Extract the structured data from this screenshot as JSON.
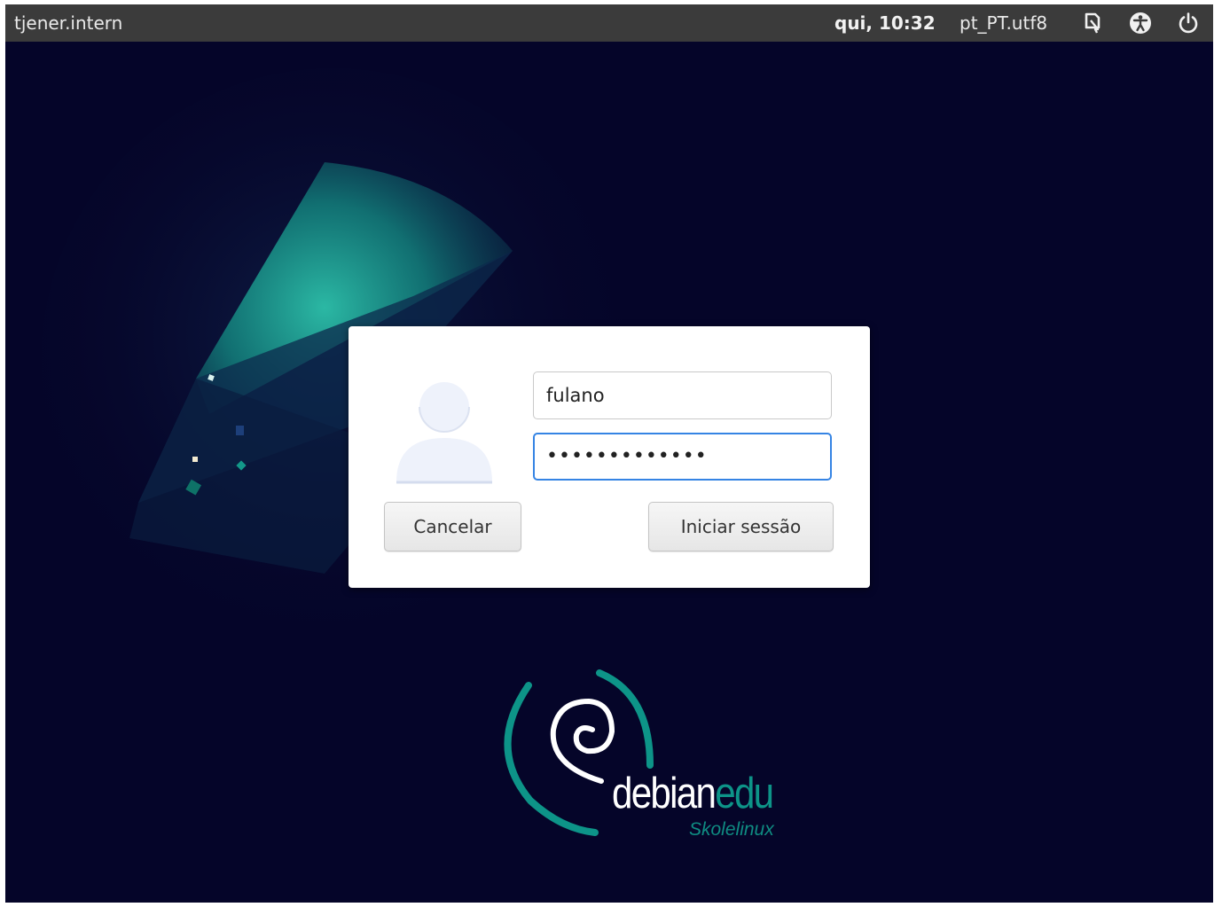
{
  "topbar": {
    "hostname": "tjener.intern",
    "clock": "qui, 10:32",
    "locale": "pt_PT.utf8",
    "icons": [
      "screen-keyboard-icon",
      "accessibility-icon",
      "power-icon"
    ]
  },
  "login": {
    "username_value": "fulano",
    "password_value": "•••••••••••••",
    "cancel_label": "Cancelar",
    "login_label": "Iniciar sessão"
  },
  "branding": {
    "word_main": "debian",
    "word_accent": "edu",
    "subtitle": "Skolelinux"
  },
  "colors": {
    "background": "#050529",
    "topbar": "#3b3b3b",
    "accent_teal": "#0d9488",
    "focus_blue": "#3584e4"
  }
}
